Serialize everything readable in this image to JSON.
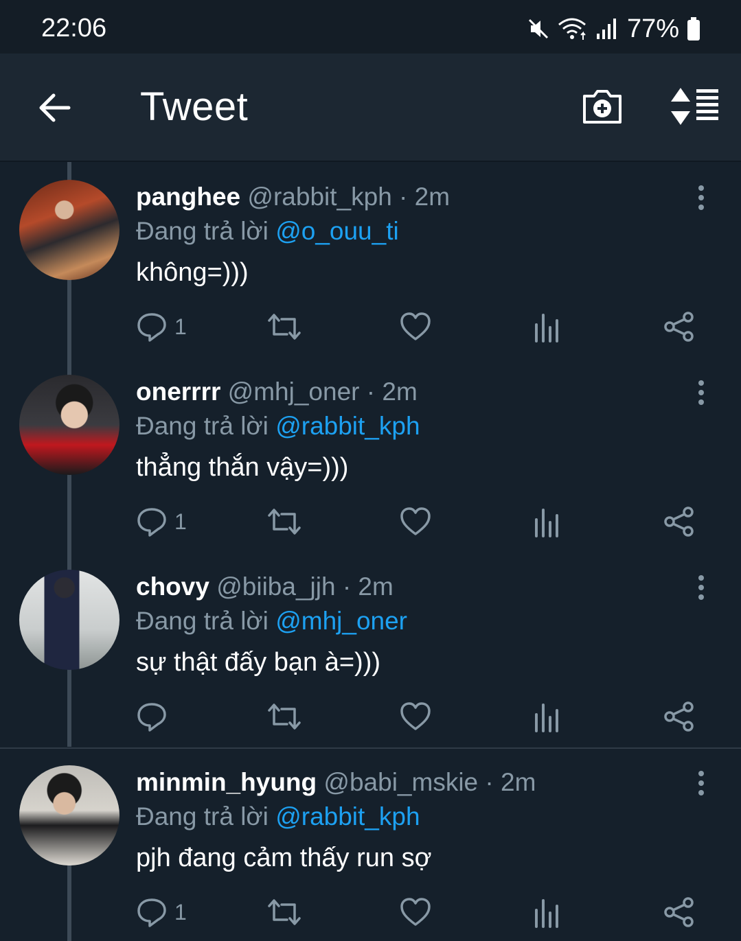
{
  "status_bar": {
    "time": "22:06",
    "battery_text": "77%",
    "icons": [
      "mute-icon",
      "wifi-icon",
      "signal-icon",
      "battery-icon"
    ]
  },
  "app_bar": {
    "title": "Tweet",
    "icons": [
      "back-arrow-icon",
      "camera-plus-icon",
      "sort-list-icon"
    ]
  },
  "colors": {
    "background": "#15202b",
    "appbar": "#1c2732",
    "muted": "#8899a6",
    "accent": "#1da1f2"
  },
  "tweets": [
    {
      "name": "panghee",
      "handle": "@rabbit_kph · 2m",
      "reply_prefix": "Đang trả lời ",
      "reply_mention": "@o_ouu_ti",
      "text": "không=)))",
      "reply_count": "1"
    },
    {
      "name": "onerrrr",
      "handle": "@mhj_oner · 2m",
      "reply_prefix": "Đang trả lời ",
      "reply_mention": "@rabbit_kph",
      "text": "thẳng thắn vậy=)))",
      "reply_count": "1"
    },
    {
      "name": "chovy",
      "handle": "@biiba_jjh · 2m",
      "reply_prefix": "Đang trả lời ",
      "reply_mention": "@mhj_oner",
      "text": "sự thật đấy bạn à=)))",
      "reply_count": ""
    },
    {
      "name": "minmin_hyung",
      "handle": "@babi_mskie · 2m",
      "reply_prefix": "Đang trả lời ",
      "reply_mention": "@rabbit_kph",
      "text": "pjh đang cảm thấy run sợ",
      "reply_count": "1"
    }
  ]
}
